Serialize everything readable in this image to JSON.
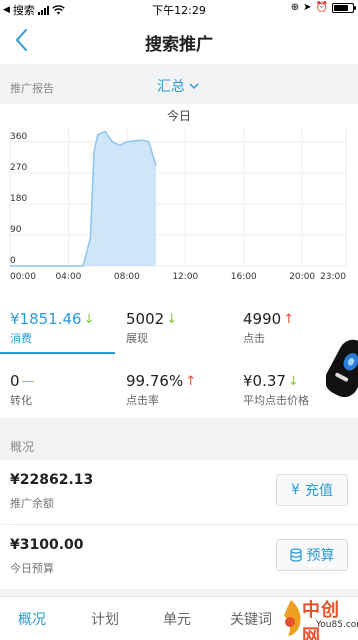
{
  "status_bar": {
    "carrier": "搜索",
    "time": "下午12:29"
  },
  "nav": {
    "title": "搜索推广"
  },
  "report": {
    "label": "推广报告",
    "summary_dropdown": "汇总"
  },
  "chart_data": {
    "type": "area",
    "title": "今日",
    "x": [
      "00:00",
      "04:00",
      "08:00",
      "12:00",
      "16:00",
      "20:00",
      "23:00"
    ],
    "y_ticks": [
      0,
      90,
      180,
      270,
      360
    ],
    "ylim": [
      0,
      400
    ],
    "series": [
      {
        "points": [
          {
            "x": "00:00",
            "y": 0
          },
          {
            "x": "05:00",
            "y": 0
          },
          {
            "x": "05:30",
            "y": 80
          },
          {
            "x": "05:45",
            "y": 330
          },
          {
            "x": "06:00",
            "y": 380
          },
          {
            "x": "06:30",
            "y": 390
          },
          {
            "x": "07:00",
            "y": 360
          },
          {
            "x": "07:30",
            "y": 350
          },
          {
            "x": "08:00",
            "y": 360
          },
          {
            "x": "09:00",
            "y": 365
          },
          {
            "x": "09:30",
            "y": 360
          },
          {
            "x": "10:00",
            "y": 290
          }
        ]
      }
    ],
    "grid": true
  },
  "metrics": [
    {
      "value": "¥1851.46",
      "trend": "down",
      "label": "消费",
      "active": true
    },
    {
      "value": "5002",
      "trend": "down",
      "label": "展现",
      "active": false
    },
    {
      "value": "4990",
      "trend": "up",
      "label": "点击",
      "active": false
    },
    {
      "value": "0",
      "trend": "flat",
      "label": "转化",
      "active": false
    },
    {
      "value": "99.76%",
      "trend": "up",
      "label": "点击率",
      "active": false
    },
    {
      "value": "¥0.37",
      "trend": "down",
      "label": "平均点击价格",
      "active": false
    }
  ],
  "overview": {
    "label": "概况",
    "balance": {
      "amount": "¥22862.13",
      "label": "推广余额",
      "button": "充值"
    },
    "budget": {
      "amount": "¥3100.00",
      "label": "今日预算",
      "button": "预算"
    }
  },
  "tabs": [
    "概况",
    "计划",
    "单元",
    "关键词"
  ],
  "watermark": {
    "text": "中创网",
    "sub": "You85.com"
  },
  "colors": {
    "accent": "#2a9bd6",
    "down": "#8cc63f",
    "up": "#e8503a",
    "area_fill": "#cfe6fa",
    "area_line": "#8cc3ef"
  }
}
